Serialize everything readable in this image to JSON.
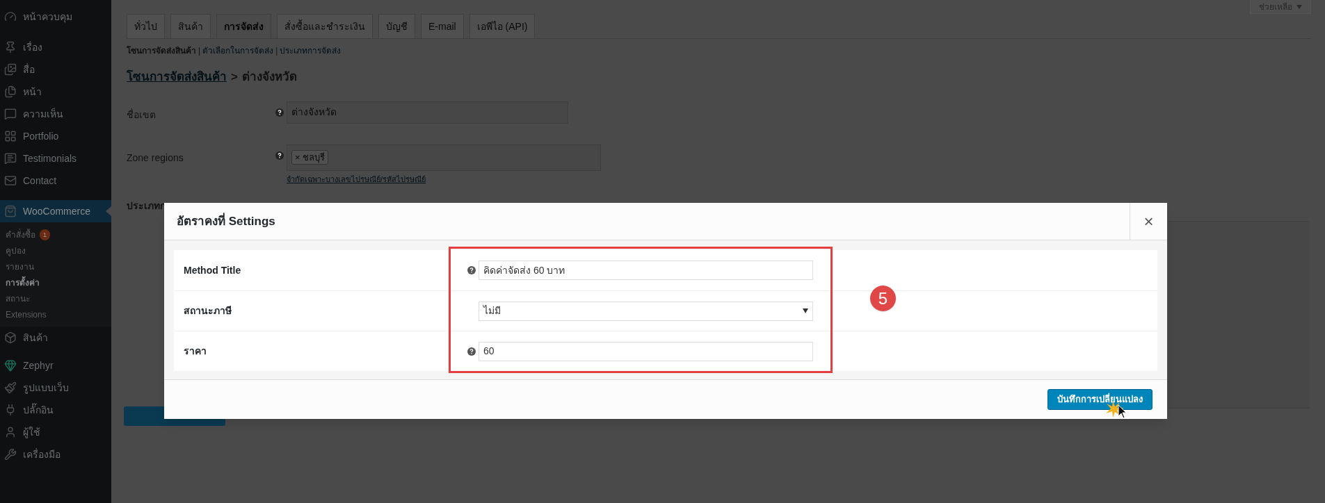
{
  "top_bar": {
    "help_button": "ช่วยเหลือ"
  },
  "sidebar": {
    "items": [
      {
        "label": "หน้าควบคุม",
        "selected": false
      },
      {
        "label": "เรื่อง",
        "selected": false
      },
      {
        "label": "สื่อ",
        "selected": false
      },
      {
        "label": "หน้า",
        "selected": false
      },
      {
        "label": "ความเห็น",
        "selected": false
      },
      {
        "label": "Portfolio",
        "selected": false
      },
      {
        "label": "Testimonials",
        "selected": false
      },
      {
        "label": "Contact",
        "selected": false
      },
      {
        "label": "WooCommerce",
        "selected": true,
        "children": [
          {
            "label": "คำสั่งซื้อ",
            "badge": "1",
            "selected": false
          },
          {
            "label": "คูปอง",
            "selected": false
          },
          {
            "label": "รายงาน",
            "selected": false
          },
          {
            "label": "การตั้งค่า",
            "selected": true
          },
          {
            "label": "สถานะ",
            "selected": false
          },
          {
            "label": "Extensions",
            "selected": false
          }
        ]
      },
      {
        "label": "สินค้า",
        "selected": false
      },
      {
        "label": "Zephyr",
        "selected": false
      },
      {
        "label": "รูปแบบเว็บ",
        "selected": false
      },
      {
        "label": "ปลั๊กอิน",
        "selected": false
      },
      {
        "label": "ผู้ใช้",
        "selected": false
      },
      {
        "label": "เครื่องมือ",
        "selected": false
      }
    ]
  },
  "tabs": [
    {
      "label": "ทั่วไป",
      "selected": false
    },
    {
      "label": "สินค้า",
      "selected": false
    },
    {
      "label": "การจัดส่ง",
      "selected": true
    },
    {
      "label": "สั่งซื้อและชำระเงิน",
      "selected": false
    },
    {
      "label": "บัญชี",
      "selected": false
    },
    {
      "label": "E-mail",
      "selected": false
    },
    {
      "label": "เอพีไอ (API)",
      "selected": false
    }
  ],
  "subnav": [
    {
      "label": "โซนการจัดส่งสินค้า",
      "selected": true
    },
    {
      "separator": "|",
      "label": "ตัวเลือกในการจัดส่ง",
      "selected": false
    },
    {
      "separator": "|",
      "label": "ประเภทการจัดส่ง",
      "selected": false
    }
  ],
  "breadcrumb": {
    "link": "โซนการจัดส่งสินค้า",
    "separator": ">",
    "current": "ต่างจังหวัด"
  },
  "form": {
    "rows": [
      {
        "label": "ชื่อเขต",
        "kind": "text",
        "value": "ต่างจังหวัด"
      },
      {
        "label": "Zone regions",
        "kind": "tags",
        "tags": [
          {
            "remove": "×",
            "label": "ชลบุรี"
          }
        ],
        "link": "จำกัดเฉพาะบางเลขไปรษณีย์/รหัสไปรษณีย์"
      }
    ],
    "partial_label": "ประเภทก"
  },
  "modal": {
    "title": "อัตราคงที่ Settings",
    "close": "×",
    "fields": [
      {
        "label": "Method Title",
        "kind": "text",
        "help": true,
        "value": "คิดค่าจัดส่ง 60 บาท"
      },
      {
        "label": "สถานะภาษี",
        "kind": "select",
        "help": false,
        "value": "ไม่มี"
      },
      {
        "label": "ราคา",
        "kind": "text",
        "help": true,
        "value": "60"
      }
    ],
    "save_button": "บันทึกการเปลี่ยนแปลง",
    "annotation_number": "5"
  }
}
